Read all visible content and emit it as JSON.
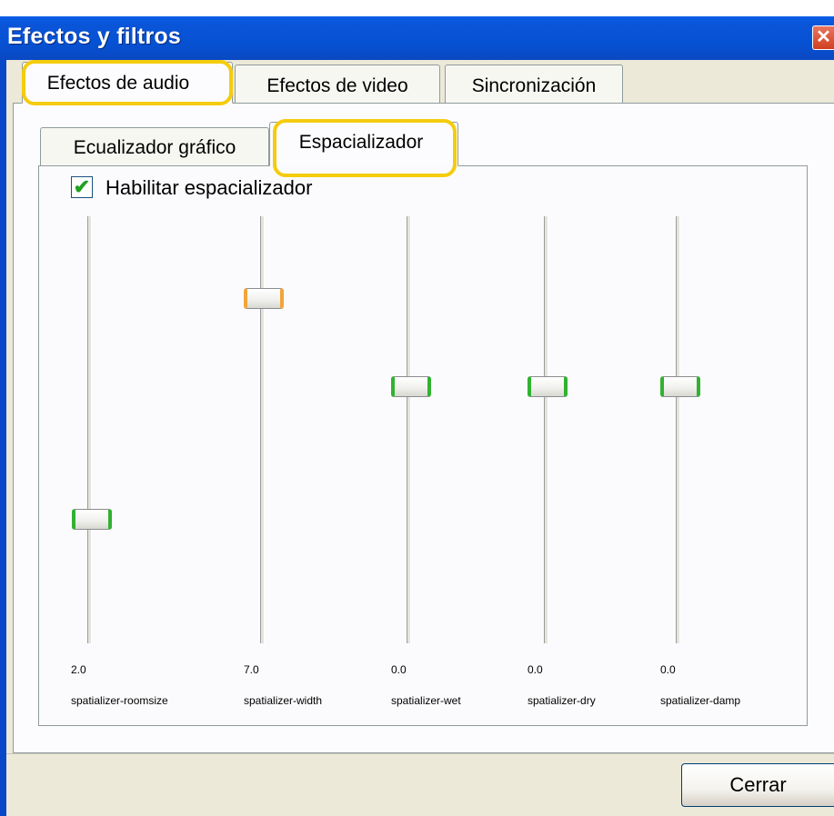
{
  "window": {
    "title": "Efectos y filtros",
    "close_glyph": "✕"
  },
  "main_tabs": [
    {
      "label": "Efectos de audio",
      "selected": true
    },
    {
      "label": "Efectos de video",
      "selected": false
    },
    {
      "label": "Sincronización",
      "selected": false
    }
  ],
  "sub_tabs": [
    {
      "label": "Ecualizador gráfico",
      "selected": false
    },
    {
      "label": "Espacializador",
      "selected": true
    }
  ],
  "enable": {
    "label": "Habilitar espacializador",
    "checked": true,
    "check_glyph": "✔"
  },
  "sliders": [
    {
      "name": "spatializer-roomsize",
      "value": "2.0",
      "level": 0.2,
      "accent": "green"
    },
    {
      "name": "spatializer-width",
      "value": "7.0",
      "level": 0.7,
      "accent": "orange"
    },
    {
      "name": "spatializer-wet",
      "value": "0.0",
      "level": 0.5,
      "accent": "green"
    },
    {
      "name": "spatializer-dry",
      "value": "0.0",
      "level": 0.5,
      "accent": "green"
    },
    {
      "name": "spatializer-damp",
      "value": "0.0",
      "level": 0.5,
      "accent": "green"
    }
  ],
  "buttons": {
    "close": "Cerrar"
  },
  "colors": {
    "highlight": "#f5cc0e",
    "title_bar": "#0a54d8",
    "thumb_accent_green": "#31b231",
    "thumb_accent_orange": "#f2a43a"
  }
}
